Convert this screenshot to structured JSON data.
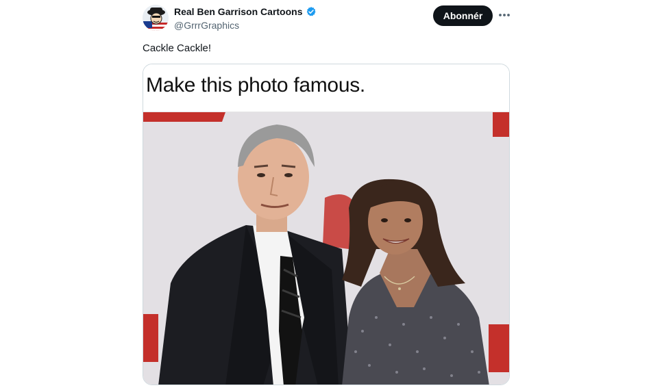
{
  "tweet": {
    "author": {
      "display_name": "Real Ben Garrison Cartoons",
      "handle": "@GrrrGraphics",
      "verified": true,
      "verified_color": "#1d9bf0",
      "avatar_icon": "cartoon-avatar"
    },
    "follow_label": "Abonnér",
    "more_icon": "more-horizontal-icon",
    "text": "Cackle Cackle!",
    "media": {
      "caption": "Make this photo famous.",
      "photo_description_icon": "photo-image"
    }
  }
}
